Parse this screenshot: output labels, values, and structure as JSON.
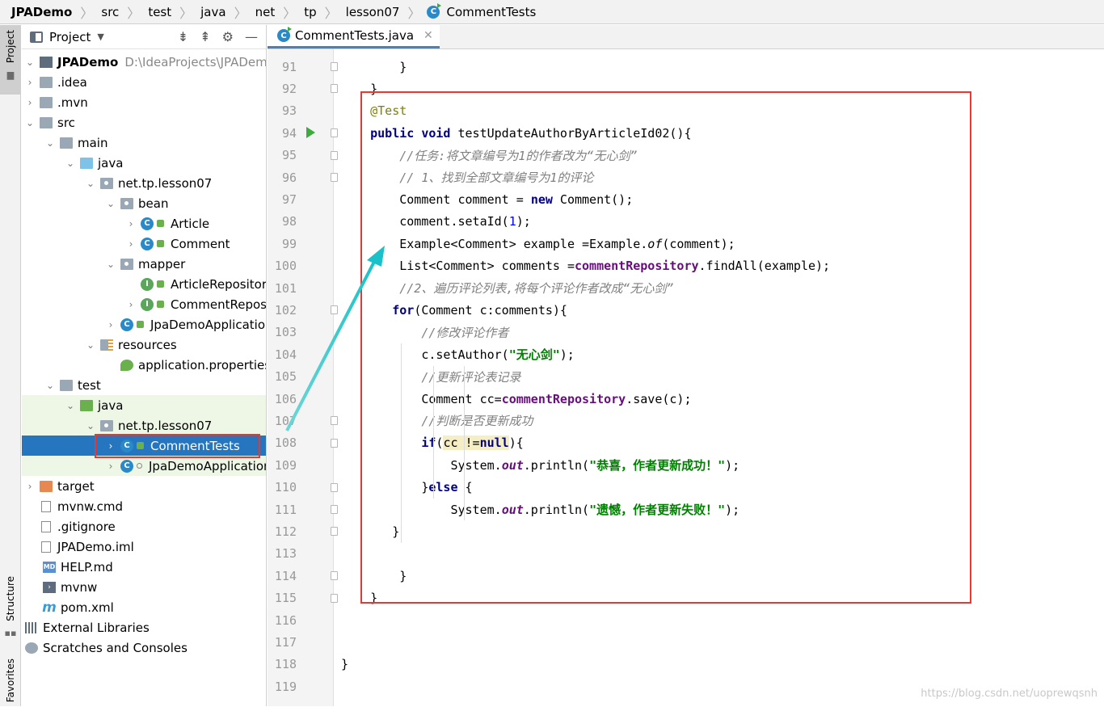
{
  "breadcrumb": [
    "JPADemo",
    "src",
    "test",
    "java",
    "net",
    "tp",
    "lesson07",
    "CommentTests"
  ],
  "side_tabs": {
    "project": "Project",
    "structure": "Structure",
    "favorites": "Favorites"
  },
  "project_panel": {
    "title": "Project",
    "tree": [
      {
        "label": "JPADemo",
        "extra": "D:\\IdeaProjects\\JPADemo"
      },
      {
        "label": ".idea"
      },
      {
        "label": ".mvn"
      },
      {
        "label": "src"
      },
      {
        "label": "main"
      },
      {
        "label": "java"
      },
      {
        "label": "net.tp.lesson07"
      },
      {
        "label": "bean"
      },
      {
        "label": "Article"
      },
      {
        "label": "Comment"
      },
      {
        "label": "mapper"
      },
      {
        "label": "ArticleRepository"
      },
      {
        "label": "CommentRepository"
      },
      {
        "label": "JpaDemoApplication"
      },
      {
        "label": "resources"
      },
      {
        "label": "application.properties"
      },
      {
        "label": "test"
      },
      {
        "label": "java"
      },
      {
        "label": "net.tp.lesson07"
      },
      {
        "label": "CommentTests"
      },
      {
        "label": "JpaDemoApplicationTests"
      },
      {
        "label": "target"
      },
      {
        "label": "mvnw.cmd"
      },
      {
        "label": ".gitignore"
      },
      {
        "label": "JPADemo.iml"
      },
      {
        "label": "HELP.md"
      },
      {
        "label": "mvnw"
      },
      {
        "label": "pom.xml"
      },
      {
        "label": "External Libraries"
      },
      {
        "label": "Scratches and Consoles"
      }
    ]
  },
  "editor": {
    "tab_label": "CommentTests.java",
    "line_numbers": [
      "91",
      "92",
      "93",
      "94",
      "95",
      "96",
      "97",
      "98",
      "99",
      "100",
      "101",
      "102",
      "103",
      "104",
      "105",
      "106",
      "107",
      "108",
      "109",
      "110",
      "111",
      "112",
      "113",
      "114",
      "115",
      "116",
      "117",
      "118",
      "119"
    ],
    "lines": [
      [
        {
          "t": "        }"
        }
      ],
      [
        {
          "t": "    }"
        }
      ],
      [
        {
          "t": "    "
        },
        {
          "t": "@Test",
          "c": "ann"
        }
      ],
      [
        {
          "t": "    "
        },
        {
          "t": "public void",
          "c": "kw"
        },
        {
          "t": " testUpdateAuthorByArticleId02(){"
        }
      ],
      [
        {
          "t": "        "
        },
        {
          "t": "//任务:将文章编号为1的作者改为“无心剑”",
          "c": "cm"
        }
      ],
      [
        {
          "t": "        "
        },
        {
          "t": "// 1、找到全部文章编号为1的评论",
          "c": "cm"
        }
      ],
      [
        {
          "t": "        Comment comment = "
        },
        {
          "t": "new",
          "c": "kw"
        },
        {
          "t": " Comment();"
        }
      ],
      [
        {
          "t": "        comment.setaId("
        },
        {
          "t": "1",
          "c": "num"
        },
        {
          "t": ");"
        }
      ],
      [
        {
          "t": "        Example<Comment> example =Example."
        },
        {
          "t": "of",
          "c": "it"
        },
        {
          "t": "(comment);"
        }
      ],
      [
        {
          "t": "        List<Comment> comments ="
        },
        {
          "t": "commentRepository",
          "c": "field"
        },
        {
          "t": ".findAll(example);"
        }
      ],
      [
        {
          "t": "        "
        },
        {
          "t": "//2、遍历评论列表,将每个评论作者改成“无心剑”",
          "c": "cm"
        }
      ],
      [
        {
          "t": "       "
        },
        {
          "t": "for",
          "c": "kw"
        },
        {
          "t": "(Comment c:comments){"
        }
      ],
      [
        {
          "t": "           "
        },
        {
          "t": "//修改评论作者",
          "c": "cm"
        }
      ],
      [
        {
          "t": "           c.setAuthor("
        },
        {
          "t": "\"无心剑\"",
          "c": "str"
        },
        {
          "t": ");"
        }
      ],
      [
        {
          "t": "           "
        },
        {
          "t": "//更新评论表记录",
          "c": "cm"
        }
      ],
      [
        {
          "t": "           Comment cc="
        },
        {
          "t": "commentRepository",
          "c": "field"
        },
        {
          "t": ".save(c);"
        }
      ],
      [
        {
          "t": "           "
        },
        {
          "t": "//判断是否更新成功",
          "c": "cm"
        }
      ],
      [
        {
          "t": "           "
        },
        {
          "t": "if",
          "c": "kw"
        },
        {
          "t": "("
        },
        {
          "t": "cc !=",
          "c": "hl"
        },
        {
          "t": "null",
          "c": "kw hl"
        },
        {
          "t": "){"
        }
      ],
      [
        {
          "t": "               System."
        },
        {
          "t": "out",
          "c": "static"
        },
        {
          "t": ".println("
        },
        {
          "t": "\"恭喜，作者更新成功！\"",
          "c": "str"
        },
        {
          "t": ");"
        }
      ],
      [
        {
          "t": "           }"
        },
        {
          "t": "else",
          "c": "kw"
        },
        {
          "t": " {"
        }
      ],
      [
        {
          "t": "               System."
        },
        {
          "t": "out",
          "c": "static"
        },
        {
          "t": ".println("
        },
        {
          "t": "\"遗憾，作者更新失败！\"",
          "c": "str"
        },
        {
          "t": ");"
        }
      ],
      [
        {
          "t": "       }"
        }
      ],
      [
        {
          "t": ""
        }
      ],
      [
        {
          "t": "        }"
        }
      ],
      [
        {
          "t": "    }"
        }
      ],
      [
        {
          "t": ""
        }
      ],
      [
        {
          "t": ""
        }
      ],
      [
        {
          "t": "}"
        }
      ],
      [
        {
          "t": ""
        }
      ]
    ]
  },
  "watermark": "https://blog.csdn.net/uoprewqsnh"
}
